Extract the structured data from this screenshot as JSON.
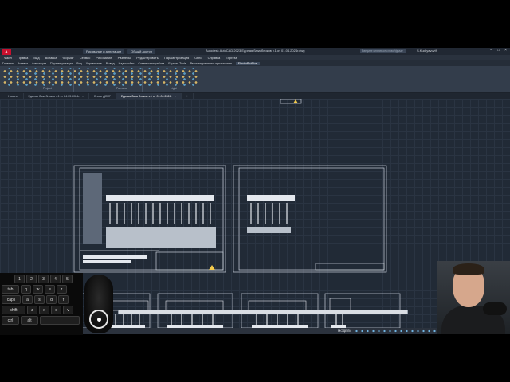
{
  "app": {
    "title": "Autodesk AutoCAD 2023  Единая база блоков v.1 от 01.04.2024г.dwg",
    "menu_button": "A CAD",
    "quick_access": [
      "Рисование и аннотации",
      "Общий доступ"
    ],
    "search_placeholder": "Введите ключевое слово/фразу",
    "user": "S.Kudryavovlf"
  },
  "menu": [
    "Файл",
    "Правка",
    "Вид",
    "Вставка",
    "Формат",
    "Сервис",
    "Рисование",
    "Размеры",
    "Редактировать",
    "Параметризация",
    "Окно",
    "Справка",
    "Express"
  ],
  "ribbon_tabs": [
    "Главная",
    "Вставка",
    "Аннотации",
    "Параметризация",
    "Вид",
    "Управление",
    "Вывод",
    "Надстройки",
    "Совместная работа",
    "Express Tools",
    "Рекомендованные приложения",
    "ElectroProPlus"
  ],
  "ribbon_active_tab": "ElectroProPlus",
  "ribbon_panels": [
    "Project",
    "Расчеты",
    "Light"
  ],
  "doc_tabs": [
    {
      "label": "Начало",
      "active": false
    },
    {
      "label": "Единая база блоков v.1 от 24.03.2024г.",
      "active": false
    },
    {
      "label": "Блоки ДСП7",
      "active": false
    },
    {
      "label": "Единая база блоков v.1 от 01.04.2024г",
      "active": true
    }
  ],
  "status": {
    "model_label": "МОДЕЛЬ"
  },
  "keyboard": {
    "rows": [
      [
        "1",
        "2",
        "3",
        "4",
        "5"
      ],
      [
        "tab",
        "q",
        "w",
        "e",
        "r"
      ],
      [
        "caps",
        "a",
        "s",
        "d",
        "f"
      ],
      [
        "shift",
        "z",
        "x",
        "c",
        "v"
      ],
      [
        "ctrl",
        "alt",
        ""
      ]
    ]
  },
  "colors": {
    "canvas_bg": "#212a36",
    "sheet_border": "#c9d1da",
    "ribbon_bg": "#333d4b",
    "titlebar_bg": "#212833",
    "accent_red": "#c8102e"
  }
}
